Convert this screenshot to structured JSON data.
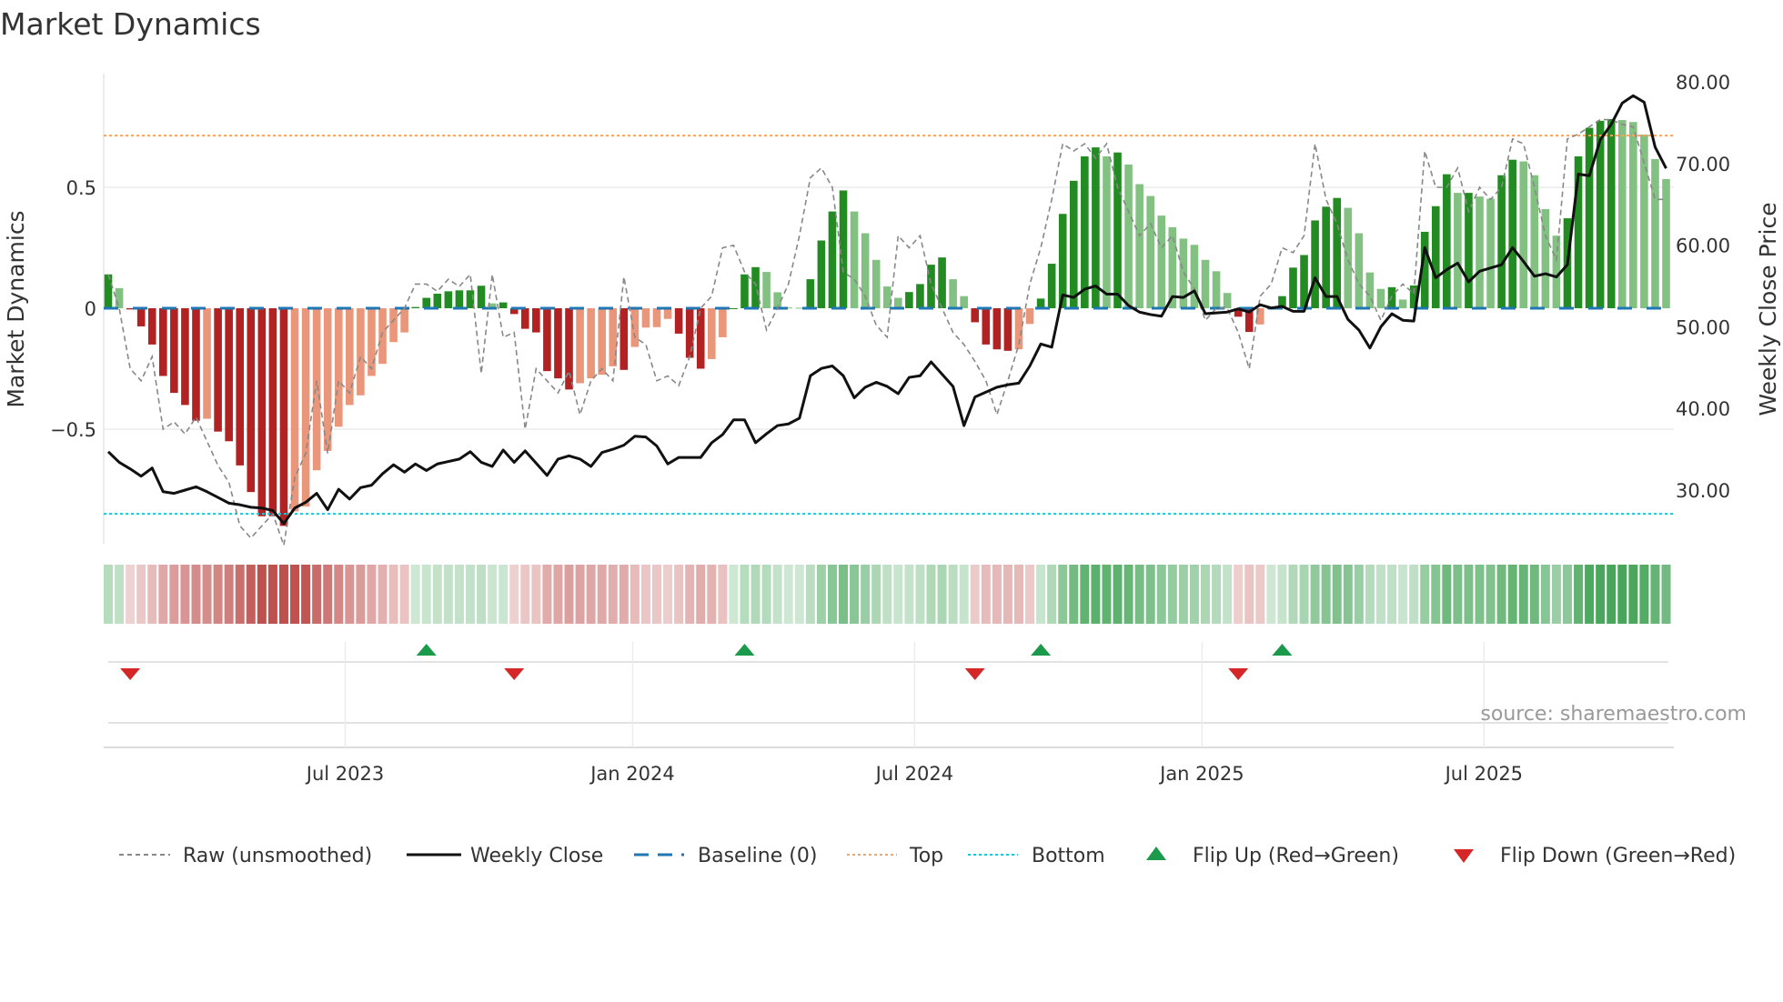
{
  "title": "Market Dynamics",
  "source": "source: sharemaestro.com",
  "colors": {
    "rise_pos": "#228b22",
    "fall_pos": "#82c182",
    "fall_neg": "#b22222",
    "rise_neg": "#e9967a",
    "close": "#111111",
    "raw": "#888888",
    "baseline": "#1f77b4",
    "top": "#f4a460",
    "bottom": "#22c4d4",
    "flip_up": "#1a9a4a",
    "flip_down": "#d62728"
  },
  "chart_data": {
    "type": "bar",
    "title": "Market Dynamics",
    "ylabel": "Market Dynamics",
    "ylabel_right": "Weekly Close Price",
    "ylim": [
      -0.97,
      0.97
    ],
    "ylim_right": [
      23.4,
      81.0
    ],
    "grid": "horizontal",
    "legend_position": "bottom",
    "yticks": [
      {
        "v": -0.5,
        "label": "−0.5"
      },
      {
        "v": 0,
        "label": "0"
      },
      {
        "v": 0.5,
        "label": "0.5"
      }
    ],
    "yticks_right": [
      {
        "v": 30,
        "label": "30.00"
      },
      {
        "v": 40,
        "label": "40.00"
      },
      {
        "v": 50,
        "label": "50.00"
      },
      {
        "v": 60,
        "label": "60.00"
      },
      {
        "v": 70,
        "label": "70.00"
      },
      {
        "v": 80,
        "label": "80.00"
      }
    ],
    "xticks": [
      {
        "week": 21.6,
        "label": "Jul 2023"
      },
      {
        "week": 47.8,
        "label": "Jan 2024"
      },
      {
        "week": 73.5,
        "label": "Jul 2024"
      },
      {
        "week": 99.7,
        "label": "Jan 2025"
      },
      {
        "week": 125.4,
        "label": "Jul 2025"
      }
    ],
    "top_level": 0.714,
    "bottom_level": -0.85,
    "baseline": 0,
    "smoothed": [
      0.14,
      0.083,
      -0.005,
      -0.075,
      -0.15,
      -0.28,
      -0.35,
      -0.4,
      -0.465,
      -0.457,
      -0.51,
      -0.55,
      -0.65,
      -0.76,
      -0.86,
      -0.86,
      -0.9,
      -0.84,
      -0.82,
      -0.67,
      -0.59,
      -0.49,
      -0.4,
      -0.36,
      -0.28,
      -0.23,
      -0.14,
      -0.1,
      0.005,
      0.043,
      0.06,
      0.07,
      0.074,
      0.074,
      0.093,
      0.02,
      0.024,
      -0.024,
      -0.085,
      -0.1,
      -0.26,
      -0.29,
      -0.336,
      -0.31,
      -0.29,
      -0.275,
      -0.24,
      -0.255,
      -0.16,
      -0.08,
      -0.078,
      -0.044,
      -0.105,
      -0.205,
      -0.25,
      -0.21,
      -0.12,
      0.0,
      0.14,
      0.17,
      0.15,
      0.066,
      0.003,
      0.002,
      0.12,
      0.28,
      0.4,
      0.487,
      0.4,
      0.31,
      0.2,
      0.09,
      0.043,
      0.067,
      0.1,
      0.18,
      0.21,
      0.12,
      0.05,
      -0.058,
      -0.15,
      -0.17,
      -0.176,
      -0.17,
      -0.065,
      0.04,
      0.184,
      0.39,
      0.527,
      0.628,
      0.665,
      0.628,
      0.644,
      0.594,
      0.513,
      0.464,
      0.383,
      0.335,
      0.288,
      0.262,
      0.2,
      0.153,
      0.063,
      -0.035,
      -0.098,
      -0.067,
      0.0,
      0.05,
      0.168,
      0.22,
      0.363,
      0.42,
      0.456,
      0.415,
      0.31,
      0.148,
      0.08,
      0.087,
      0.036,
      0.094,
      0.316,
      0.422,
      0.554,
      0.477,
      0.477,
      0.462,
      0.453,
      0.55,
      0.614,
      0.607,
      0.55,
      0.41,
      0.3,
      0.372,
      0.628,
      0.746,
      0.775,
      0.782,
      0.778,
      0.77,
      0.718,
      0.617,
      0.534
    ],
    "raw": [
      0.14,
      0.0,
      -0.25,
      -0.3,
      -0.2,
      -0.5,
      -0.47,
      -0.52,
      -0.45,
      -0.55,
      -0.65,
      -0.72,
      -0.9,
      -0.95,
      -0.9,
      -0.85,
      -0.98,
      -0.7,
      -0.6,
      -0.3,
      -0.6,
      -0.3,
      -0.35,
      -0.2,
      -0.25,
      -0.1,
      -0.05,
      0.0,
      0.1,
      0.1,
      0.07,
      0.12,
      0.09,
      0.14,
      -0.27,
      0.14,
      -0.12,
      -0.1,
      -0.5,
      -0.25,
      -0.3,
      -0.35,
      -0.26,
      -0.44,
      -0.3,
      -0.25,
      -0.3,
      0.13,
      -0.12,
      -0.15,
      -0.3,
      -0.28,
      -0.32,
      -0.2,
      0.0,
      0.05,
      0.25,
      0.26,
      0.15,
      0.1,
      -0.09,
      0.0,
      0.1,
      0.3,
      0.54,
      0.58,
      0.5,
      0.15,
      0.12,
      0.05,
      -0.07,
      -0.12,
      0.3,
      0.25,
      0.3,
      0.1,
      0.0,
      -0.1,
      -0.15,
      -0.22,
      -0.3,
      -0.44,
      -0.3,
      -0.15,
      0.1,
      0.25,
      0.45,
      0.68,
      0.65,
      0.68,
      0.62,
      0.68,
      0.5,
      0.4,
      0.3,
      0.35,
      0.25,
      0.3,
      0.15,
      0.08,
      -0.05,
      0.0,
      0.0,
      -0.1,
      -0.25,
      0.05,
      0.1,
      0.25,
      0.23,
      0.3,
      0.68,
      0.45,
      0.35,
      0.2,
      0.1,
      0.05,
      -0.05,
      0.05,
      0.1,
      0.06,
      0.65,
      0.5,
      0.5,
      0.58,
      0.4,
      0.5,
      0.45,
      0.5,
      0.7,
      0.68,
      0.5,
      0.3,
      0.2,
      0.7,
      0.72,
      0.75,
      0.78,
      0.78,
      0.76,
      0.75,
      0.6,
      0.45,
      0.45
    ],
    "close": [
      34.7,
      33.4,
      32.6,
      31.7,
      32.7,
      29.8,
      29.6,
      30.0,
      30.4,
      29.8,
      29.1,
      28.4,
      28.2,
      27.9,
      27.8,
      27.5,
      25.9,
      27.8,
      28.5,
      29.6,
      27.6,
      30.1,
      28.9,
      30.3,
      30.6,
      32.0,
      33.1,
      32.2,
      33.2,
      32.4,
      33.2,
      33.5,
      33.8,
      34.7,
      33.4,
      32.9,
      34.9,
      33.4,
      34.8,
      33.3,
      31.8,
      33.8,
      34.2,
      33.8,
      32.9,
      34.6,
      35.0,
      35.5,
      36.6,
      36.5,
      35.4,
      33.2,
      34.0,
      34.0,
      34.0,
      35.8,
      36.8,
      38.6,
      38.6,
      35.8,
      36.9,
      37.9,
      38.1,
      38.8,
      44.0,
      44.9,
      45.2,
      44.0,
      41.3,
      42.6,
      43.2,
      42.7,
      41.8,
      43.8,
      44.0,
      45.7,
      44.2,
      42.7,
      37.9,
      41.4,
      42.0,
      42.6,
      42.9,
      43.1,
      45.2,
      47.9,
      47.5,
      53.9,
      53.6,
      54.6,
      55.0,
      54.0,
      54.0,
      52.6,
      51.8,
      51.5,
      51.3,
      53.7,
      53.6,
      54.4,
      51.6,
      51.7,
      51.8,
      52.2,
      51.8,
      52.7,
      52.3,
      52.5,
      51.9,
      51.9,
      56.0,
      53.7,
      53.7,
      50.9,
      49.6,
      47.4,
      50.0,
      51.6,
      50.8,
      50.7,
      59.7,
      56.0,
      57.0,
      57.8,
      55.5,
      56.8,
      57.2,
      57.6,
      59.7,
      58.0,
      56.2,
      56.5,
      56.1,
      57.6,
      68.7,
      68.5,
      72.9,
      74.8,
      77.4,
      78.3,
      77.5,
      72.0,
      69.4
    ],
    "flip_up_weeks": [
      29,
      58,
      85,
      107
    ],
    "flip_down_weeks": [
      2,
      37,
      79,
      103
    ],
    "legend": {
      "raw": "Raw (unsmoothed)",
      "close": "Weekly Close",
      "baseline": "Baseline (0)",
      "top": "Top",
      "bottom": "Bottom",
      "flip_up": "Flip Up (Red→Green)",
      "flip_down": "Flip Down (Green→Red)"
    }
  }
}
